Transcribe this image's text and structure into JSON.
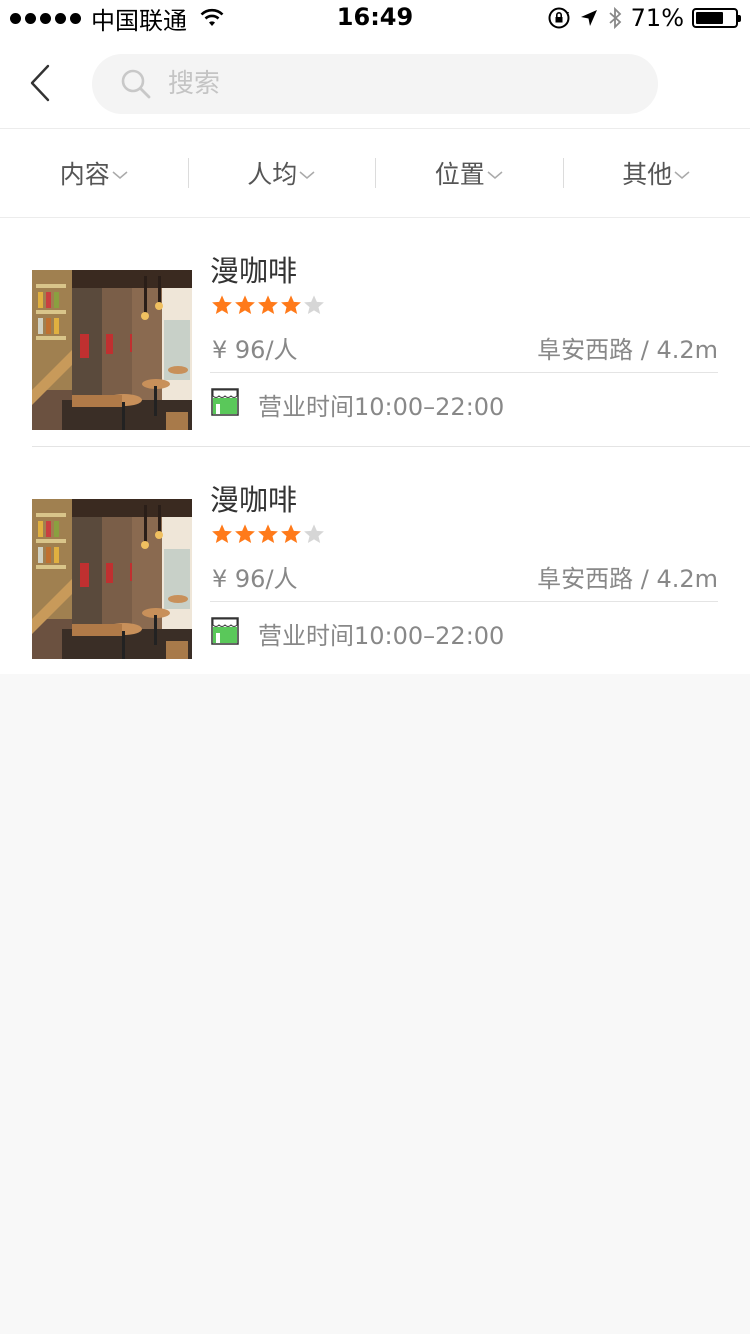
{
  "status_bar": {
    "carrier": "中国联通",
    "time": "16:49",
    "battery_percent": "71%",
    "battery_level": 0.71,
    "icons": [
      "signal-dots-icon",
      "wifi-icon",
      "rotation-lock-icon",
      "location-arrow-icon",
      "bluetooth-icon",
      "battery-icon"
    ]
  },
  "header": {
    "back_icon": "chevron-left-icon",
    "search": {
      "placeholder": "搜索",
      "value": "",
      "icon": "search-icon"
    }
  },
  "filters": [
    {
      "label": "内容",
      "icon": "chevron-down-icon"
    },
    {
      "label": "人均",
      "icon": "chevron-down-icon"
    },
    {
      "label": "位置",
      "icon": "chevron-down-icon"
    },
    {
      "label": "其他",
      "icon": "chevron-down-icon"
    }
  ],
  "shops": [
    {
      "name": "漫咖啡",
      "rating": 4,
      "rating_max": 5,
      "price": "¥ 96/人",
      "location": "阜安西路 / 4.2m",
      "hours": "营业时间10:00–22:00",
      "hours_icon": "storefront-icon"
    },
    {
      "name": "漫咖啡",
      "rating": 4,
      "rating_max": 5,
      "price": "¥ 96/人",
      "location": "阜安西路 / 4.2m",
      "hours": "营业时间10:00–22:00",
      "hours_icon": "storefront-icon"
    }
  ],
  "colors": {
    "star_active": "#ff7a1a",
    "star_inactive": "#d6d6d6",
    "store_icon_green": "#5ac85a",
    "background": "#f8f8f8"
  }
}
